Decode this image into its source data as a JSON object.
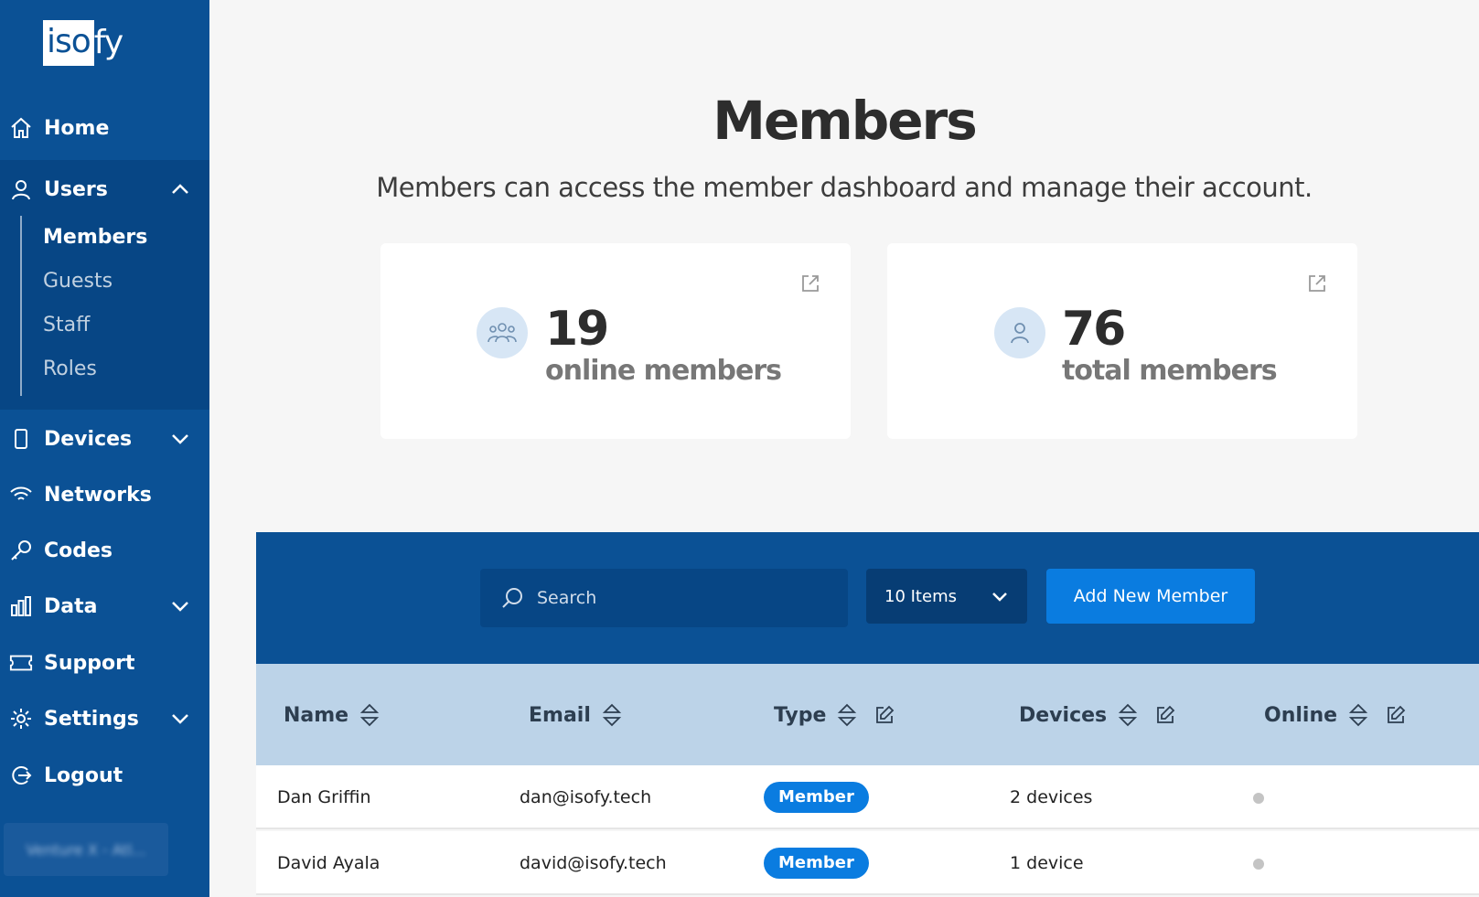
{
  "brand": {
    "logo_boxed": "iso",
    "logo_rest": "fy"
  },
  "sidebar": {
    "home": "Home",
    "users": "Users",
    "users_sub": [
      "Members",
      "Guests",
      "Staff",
      "Roles"
    ],
    "devices": "Devices",
    "networks": "Networks",
    "codes": "Codes",
    "data": "Data",
    "support": "Support",
    "settings": "Settings",
    "logout": "Logout",
    "account": "Venture X - Atl..."
  },
  "page": {
    "title": "Members",
    "subtitle": "Members can access the member dashboard and manage their account."
  },
  "stats": [
    {
      "value": "19",
      "label": "online members",
      "icon": "group-icon"
    },
    {
      "value": "76",
      "label": "total members",
      "icon": "person-icon"
    }
  ],
  "toolbar": {
    "search_placeholder": "Search",
    "items_select": "10 Items",
    "add_button": "Add New Member"
  },
  "table": {
    "columns": [
      "Name",
      "Email",
      "Type",
      "Devices",
      "Online"
    ],
    "rows": [
      {
        "name": "Dan Griffin",
        "email": "dan@isofy.tech",
        "type": "Member",
        "devices": "2 devices"
      },
      {
        "name": "David Ayala",
        "email": "david@isofy.tech",
        "type": "Member",
        "devices": "1 device"
      }
    ]
  },
  "colors": {
    "sidebar": "#0b5195",
    "accent": "#0a7ce0",
    "header_row": "#bcd3e8"
  }
}
